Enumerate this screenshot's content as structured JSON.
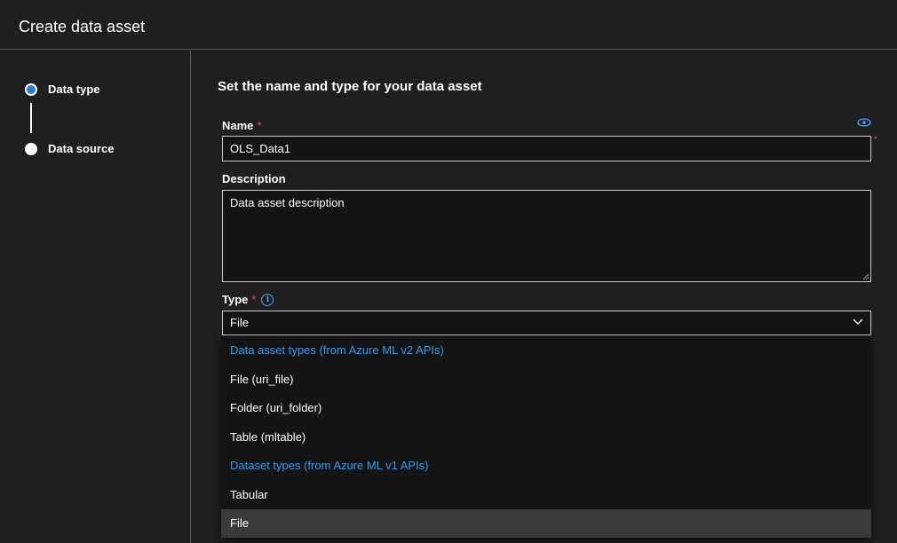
{
  "header": {
    "title": "Create data asset"
  },
  "steps": [
    {
      "label": "Data type",
      "active": true
    },
    {
      "label": "Data source",
      "active": false
    }
  ],
  "form": {
    "section_title": "Set the name and type for your data asset",
    "name": {
      "label": "Name",
      "required_marker": "*",
      "value": "OLS_Data1",
      "icon": "eye-icon"
    },
    "description": {
      "label": "Description",
      "placeholder": "Data asset description"
    },
    "type": {
      "label": "Type",
      "required_marker": "*",
      "selected": "File",
      "info_icon": "info-icon"
    }
  },
  "dropdown": {
    "items": [
      {
        "text": "Data asset types (from Azure ML v2 APIs)",
        "kind": "header"
      },
      {
        "text": "File (uri_file)",
        "kind": "option"
      },
      {
        "text": "Folder (uri_folder)",
        "kind": "option"
      },
      {
        "text": "Table (mltable)",
        "kind": "option"
      },
      {
        "text": "Dataset types (from Azure ML v1 APIs)",
        "kind": "header"
      },
      {
        "text": "Tabular",
        "kind": "option"
      },
      {
        "text": "File",
        "kind": "option",
        "selected": true
      }
    ]
  },
  "colors": {
    "accent": "#3b9ae8",
    "required": "#e34b4b",
    "step_active": "#2f7ad1"
  }
}
